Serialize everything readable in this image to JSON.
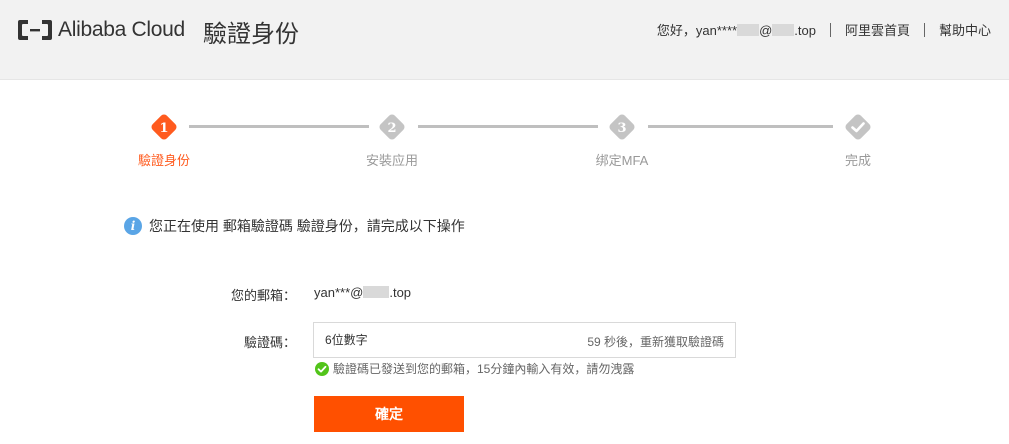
{
  "header": {
    "brand": "Alibaba Cloud",
    "title": "驗證身份",
    "greeting_prefix": "您好，yan****",
    "greeting_mid": "@",
    "greeting_suffix": ".top",
    "home_link": "阿里雲首頁",
    "help_link": "幫助中心"
  },
  "steps": [
    {
      "number": "1",
      "label": "驗證身份",
      "state": "active"
    },
    {
      "number": "2",
      "label": "安裝应用",
      "state": "pending"
    },
    {
      "number": "3",
      "label": "绑定MFA",
      "state": "pending"
    },
    {
      "number": "",
      "label": "完成",
      "state": "pending",
      "icon": "check-icon"
    }
  ],
  "info": {
    "icon": "info-icon",
    "text": "您正在使用 郵箱驗證碼 驗證身份，請完成以下操作"
  },
  "form": {
    "email_label": "您的郵箱：",
    "email_prefix": "yan***@",
    "email_suffix": ".top",
    "code_label": "驗證碼：",
    "code_placeholder": "6位數字",
    "code_value": "",
    "resend_text": "59 秒後，重新獲取驗證碼",
    "hint": "驗證碼已發送到您的郵箱，15分鐘內輸入有效，請勿洩露",
    "submit_label": "確定"
  },
  "colors": {
    "accent": "#ff5000",
    "active_step": "#ff5b1f",
    "pending_step": "#bfbfbf",
    "info": "#5aa5e6",
    "success": "#52c41a"
  }
}
